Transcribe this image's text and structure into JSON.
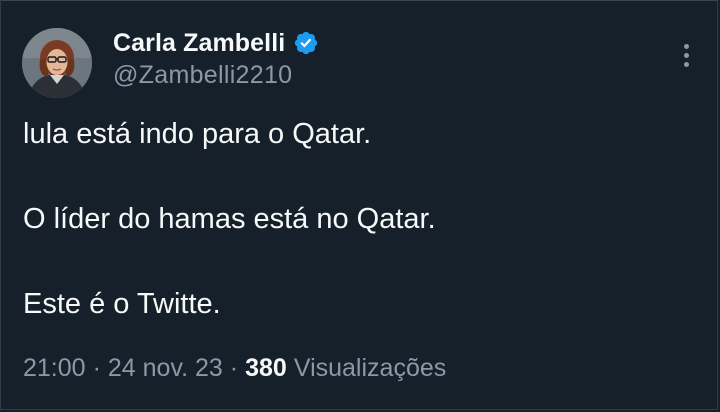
{
  "author": {
    "display_name": "Carla Zambelli",
    "handle": "@Zambelli2210",
    "verified_icon": "verified-badge-icon",
    "verified_color": "#1d9bf0"
  },
  "menu_icon": "more-vertical-icon",
  "tweet": {
    "lines": [
      "lula está indo para o Qatar.",
      "O líder do hamas está no Qatar.",
      "Este é o Twitte."
    ]
  },
  "meta": {
    "time": "21:00",
    "separator": "·",
    "date": "24 nov. 23",
    "views_count": "380",
    "views_label": "Visualizações"
  },
  "colors": {
    "background": "#15202b",
    "primary_text": "#f7f9f9",
    "secondary_text": "#8b98a5"
  }
}
